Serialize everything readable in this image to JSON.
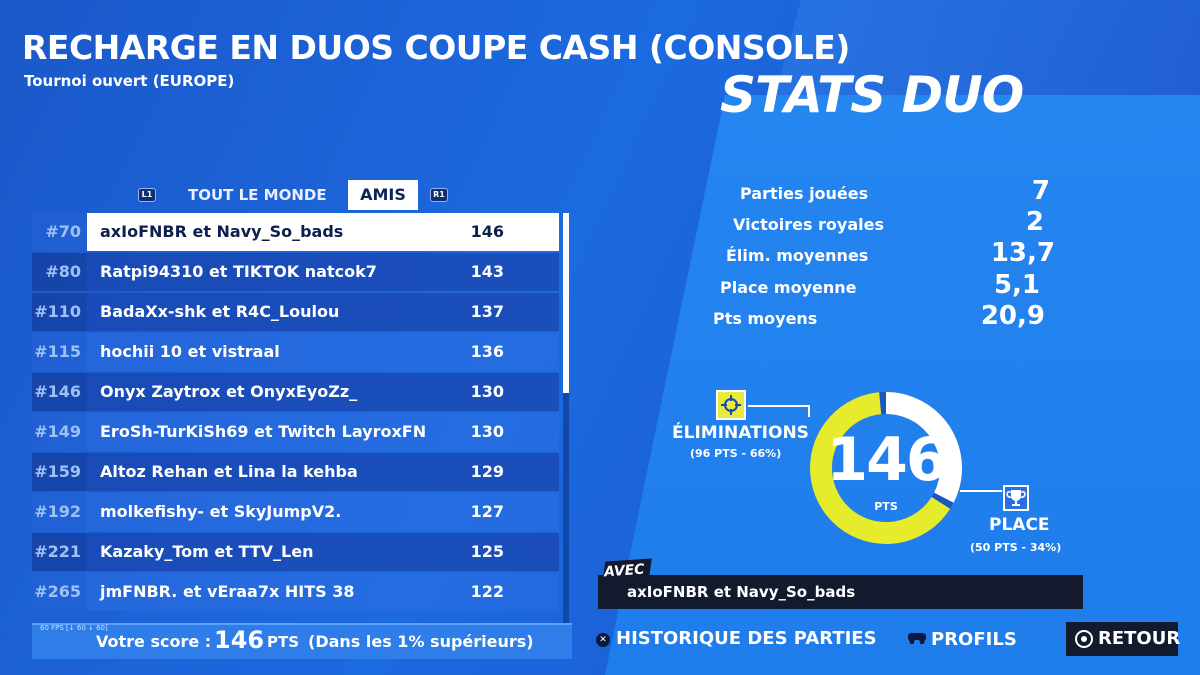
{
  "header": {
    "title": "RECHARGE EN DUOS COUPE CASH (CONSOLE)",
    "subtitle": "Tournoi ouvert (EUROPE)"
  },
  "tabs": {
    "left_button": "L1",
    "all_label": "TOUT LE MONDE",
    "friends_label": "AMIS",
    "right_button": "R1"
  },
  "leaderboard": {
    "rows": [
      {
        "rank": "#70",
        "name": "axIoFNBR et Navy_So_bads",
        "points": "146"
      },
      {
        "rank": "#80",
        "name": "Ratpi94310 et TIKTOK natcok7",
        "points": "143"
      },
      {
        "rank": "#110",
        "name": "BadaXx-shk et R4C_Loulou",
        "points": "137"
      },
      {
        "rank": "#115",
        "name": "hochii 10 et vistraal",
        "points": "136"
      },
      {
        "rank": "#146",
        "name": "Onyx Zaytrox et OnyxEyoZz_",
        "points": "130"
      },
      {
        "rank": "#149",
        "name": "EroSh-TurKiSh69 et Twitch LayroxFN",
        "points": "130"
      },
      {
        "rank": "#159",
        "name": "Altoz Rehan et Lina la kehba",
        "points": "129"
      },
      {
        "rank": "#192",
        "name": "molkefishy- et SkyJumpV2.",
        "points": "127"
      },
      {
        "rank": "#221",
        "name": "Kazaky_Tom et TTV_Len",
        "points": "125"
      },
      {
        "rank": "#265",
        "name": "jmFNBR. et vEraa7x HITS 38",
        "points": "122"
      }
    ]
  },
  "score": {
    "fps_text": "60 FPS [↓ 60 ↓ 60]",
    "label": "Votre score :",
    "value": "146",
    "unit": "PTS",
    "note": "(Dans les 1% supérieurs)"
  },
  "stats": {
    "title": "STATS DUO",
    "items": [
      {
        "label": "Parties jouées",
        "value": "7"
      },
      {
        "label": "Victoires royales",
        "value": "2"
      },
      {
        "label": "Élim. moyennes",
        "value": "13,7"
      },
      {
        "label": "Place moyenne",
        "value": "5,1"
      },
      {
        "label": "Pts moyens",
        "value": "20,9"
      }
    ]
  },
  "breakdown": {
    "total": "146",
    "unit": "PTS",
    "eliminations_label": "ÉLIMINATIONS",
    "eliminations_detail": "(96 PTS - 66%)",
    "eliminations_share": 0.66,
    "place_label": "PLACE",
    "place_detail": "(50 PTS - 34%)",
    "place_share": 0.34,
    "colors": {
      "eliminations": "#e6ec2c",
      "place": "#ffffff",
      "accent_dark": "#141a2e"
    }
  },
  "partner": {
    "tag": "AVEC",
    "name": "axIoFNBR et Navy_So_bads"
  },
  "nav": {
    "history_icon": "✕",
    "history_label": "HISTORIQUE DES PARTIES",
    "profiles_icon": "gamepad-icon",
    "profiles_label": "PROFILS",
    "back_icon": "circle-button-icon",
    "back_label": "RETOUR"
  }
}
